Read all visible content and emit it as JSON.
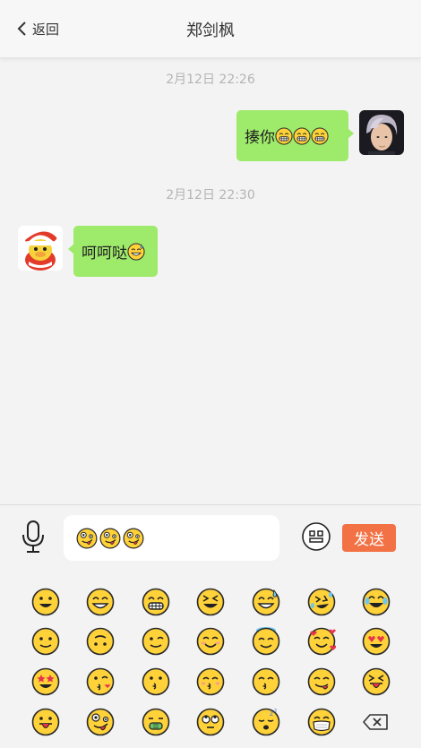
{
  "header": {
    "back_label": "返回",
    "title": "郑剑枫"
  },
  "messages": [
    {
      "time": "2月12日 22:26",
      "side": "right",
      "text": "揍你",
      "emojis": [
        "grin-teeth",
        "grin-teeth",
        "grin-teeth"
      ],
      "avatar": "male-avatar-photo"
    },
    {
      "time": "2月12日 22:30",
      "side": "left",
      "text": "呵呵哒",
      "emojis": [
        "sweat-smile"
      ],
      "avatar": "santa-duck-avatar"
    }
  ],
  "composer": {
    "draft_emojis": [
      "zany",
      "zany",
      "zany"
    ],
    "send_label": "发送",
    "icons": {
      "mic": "microphone-icon",
      "toggle": "keyboard-emoji-toggle-icon"
    }
  },
  "emoji_panel": {
    "rows": [
      [
        "grinning",
        "beaming",
        "grin-teeth",
        "squinting-laugh",
        "sweat-smile",
        "rofl",
        "tears-of-joy"
      ],
      [
        "slight-smile",
        "upside-down",
        "wink",
        "smiling-eyes",
        "halo",
        "hearts-face",
        "heart-eyes"
      ],
      [
        "star-struck",
        "kissing-heart",
        "kissing",
        "kissing-blush",
        "kissing-smiling",
        "yum",
        "squint-tongue"
      ],
      [
        "tongue",
        "zany",
        "money-mouth",
        "rolling-eyes",
        "sleeping",
        "mask",
        "backspace"
      ]
    ]
  },
  "colors": {
    "bubble": "#9eea6a",
    "send_button": "#f27245",
    "emoji_fill": "#ffd23a",
    "background": "#f3f3f3"
  }
}
